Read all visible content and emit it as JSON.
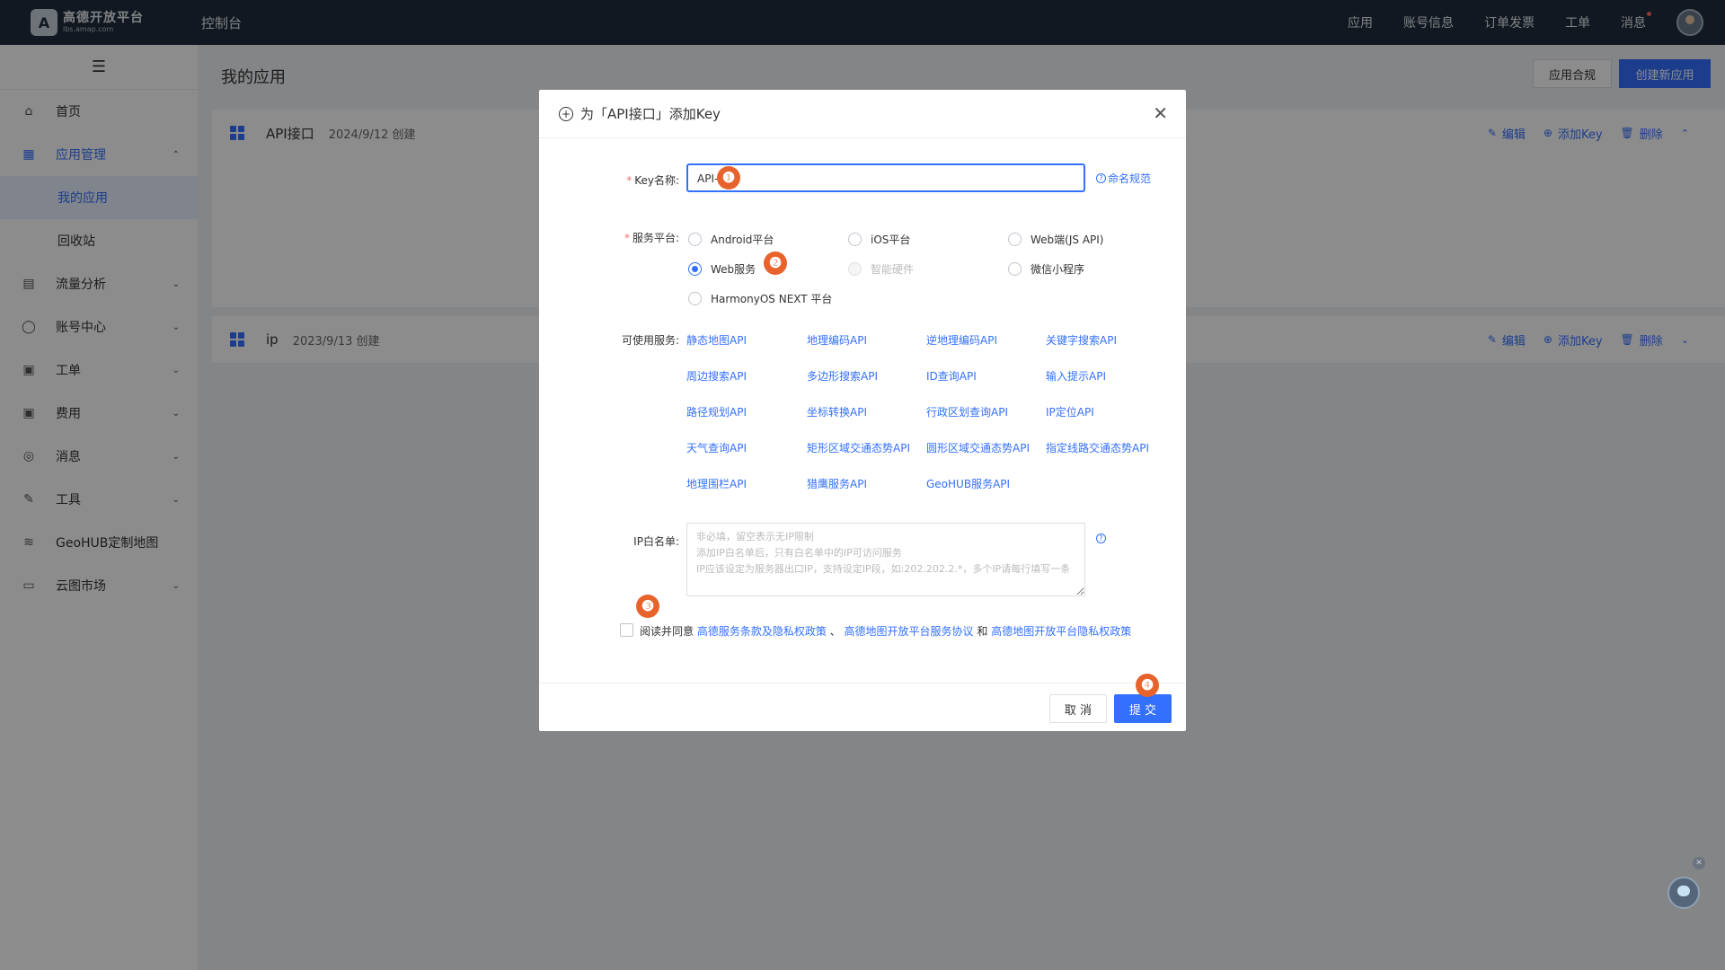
{
  "topbar": {
    "logo_name": "高德开放平台",
    "logo_url": "lbs.amap.com",
    "console": "控制台",
    "nav": [
      "应用",
      "账号信息",
      "订单发票",
      "工单",
      "消息"
    ]
  },
  "sidebar": {
    "items": [
      {
        "label": "首页",
        "icon": "home-icon"
      },
      {
        "label": "应用管理",
        "icon": "grid-icon"
      },
      {
        "label": "流量分析",
        "icon": "chart-icon"
      },
      {
        "label": "账号中心",
        "icon": "user-icon"
      },
      {
        "label": "工单",
        "icon": "ticket-icon"
      },
      {
        "label": "费用",
        "icon": "billing-icon"
      },
      {
        "label": "消息",
        "icon": "message-icon"
      },
      {
        "label": "工具",
        "icon": "wrench-icon"
      },
      {
        "label": "GeoHUB定制地图",
        "icon": "layers-icon"
      },
      {
        "label": "云图市场",
        "icon": "store-icon"
      }
    ],
    "sub": [
      "我的应用",
      "回收站"
    ]
  },
  "page": {
    "title": "我的应用",
    "compliance_btn": "应用合规",
    "create_btn": "创建新应用"
  },
  "apps": [
    {
      "name": "API接口",
      "date": "2024/9/12 创建"
    },
    {
      "name": "ip",
      "date": "2023/9/13 创建"
    }
  ],
  "app_actions": {
    "edit": "编辑",
    "add_key": "添加Key",
    "delete": "删除"
  },
  "modal": {
    "title": "为「API接口」添加Key",
    "key_label": "Key名称:",
    "key_value": "API-接口",
    "naming_link": "命名规范",
    "platform_label": "服务平台:",
    "platforms": [
      "Android平台",
      "iOS平台",
      "Web端(JS API)",
      "Web服务",
      "智能硬件",
      "微信小程序",
      "HarmonyOS NEXT 平台"
    ],
    "selected_platform": "Web服务",
    "services_label": "可使用服务:",
    "services": [
      "静态地图API",
      "地理编码API",
      "逆地理编码API",
      "关键字搜索API",
      "周边搜索API",
      "多边形搜索API",
      "ID查询API",
      "输入提示API",
      "路径规划API",
      "坐标转换API",
      "行政区划查询API",
      "IP定位API",
      "天气查询API",
      "矩形区域交通态势API",
      "圆形区域交通态势API",
      "指定线路交通态势API",
      "地理围栏API",
      "猎鹰服务API",
      "GeoHUB服务API"
    ],
    "ip_label": "IP白名单:",
    "ip_placeholder": "非必填，留空表示无IP限制\n添加IP白名单后，只有白名单中的IP可访问服务\nIP应该设定为服务器出口IP，支持设定IP段，如:202.202.2.*，多个IP请每行填写一条",
    "agree_prefix": "阅读并同意",
    "agree_link1": "高德服务条款及隐私权政策",
    "agree_sep1": "、",
    "agree_link2": "高德地图开放平台服务协议",
    "agree_sep2": "和",
    "agree_link3": "高德地图开放平台隐私权政策",
    "cancel": "取 消",
    "submit": "提 交"
  },
  "badges": [
    "❶",
    "❷",
    "❸",
    "❹"
  ],
  "colors": {
    "accent": "#3370ff",
    "topbar": "#1f2d3d",
    "badge": "#e8622c"
  }
}
